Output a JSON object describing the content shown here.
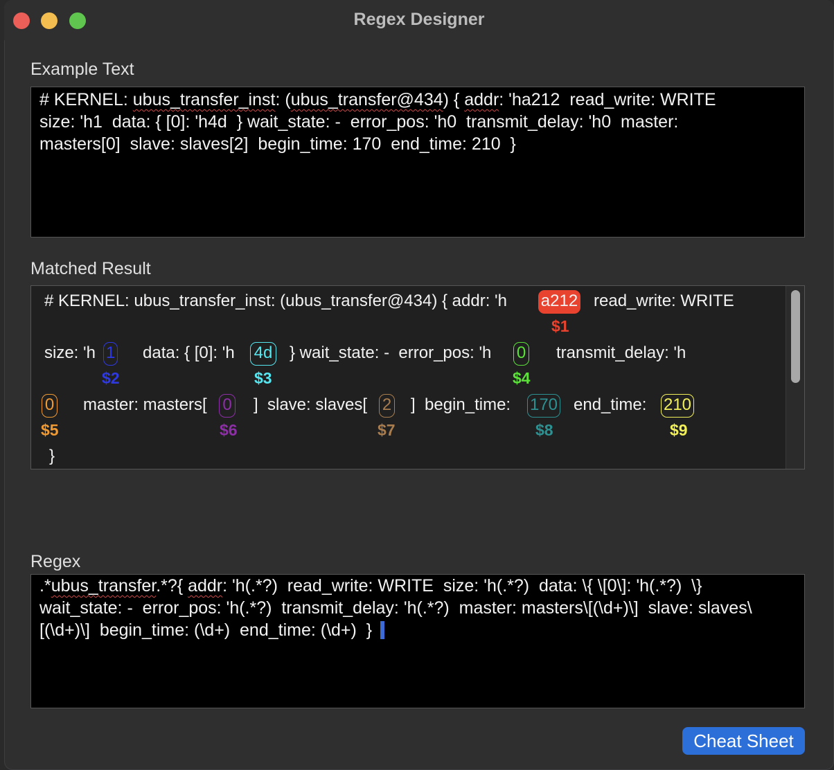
{
  "window": {
    "title": "Regex Designer"
  },
  "example": {
    "label": "Example Text",
    "line1_a": "# KERNEL: ",
    "line1_b": "ubus_transfer_inst",
    "line1_c": ": (",
    "line1_d": "ubus_transfer@434",
    "line1_e": ") { ",
    "line1_f": "addr",
    "line1_g": ": 'ha212  read_write: WRITE",
    "line2": "size: 'h1  data: { [0]: 'h4d  } wait_state: -  error_pos: 'h0  transmit_delay: 'h0  master:",
    "line3": "masters[0]  slave: slaves[2]  begin_time: 170  end_time: 210  }"
  },
  "result": {
    "label": "Matched Result",
    "row1_text": "# KERNEL: ubus_transfer_inst: (ubus_transfer@434) { addr: 'h",
    "row1_tail": "read_write: WRITE",
    "row2_a": "size: 'h",
    "row2_b": "data: { [0]: 'h",
    "row2_c": "} wait_state: -  error_pos: 'h",
    "row2_d": "transmit_delay: 'h",
    "row3_a": "master: masters[",
    "row3_b": "]  slave: slaves[",
    "row3_c": "]  begin_time:",
    "row3_d": "end_time:",
    "row4": "}",
    "captures": [
      {
        "value": "a212",
        "group": "$1",
        "color": "#e8432f"
      },
      {
        "value": "1",
        "group": "$2",
        "color": "#2f39e0"
      },
      {
        "value": "4d",
        "group": "$3",
        "color": "#56e6ef"
      },
      {
        "value": "0",
        "group": "$4",
        "color": "#5ce03a"
      },
      {
        "value": "0",
        "group": "$5",
        "color": "#f09a33"
      },
      {
        "value": "0",
        "group": "$6",
        "color": "#8d2fa6"
      },
      {
        "value": "2",
        "group": "$7",
        "color": "#a97d4e"
      },
      {
        "value": "170",
        "group": "$8",
        "color": "#2d9191"
      },
      {
        "value": "210",
        "group": "$9",
        "color": "#f2f05a"
      }
    ]
  },
  "regex": {
    "label": "Regex",
    "line1_a": ".*",
    "line1_b": "ubus_transfer",
    "line1_c": ".*?{ ",
    "line1_d": "addr",
    "line1_e": ": 'h(.*?)  read_write: WRITE  size: 'h(.*?)  data: \\{ \\[0\\]: 'h(.*?)  \\}",
    "line2": "wait_state: -  error_pos: 'h(.*?)  transmit_delay: 'h(.*?)  master: masters\\[(\\d+)\\]  slave: slaves\\",
    "line3": "[(\\d+)\\]  begin_time: (\\d+)  end_time: (\\d+)  }"
  },
  "buttons": {
    "cheat_sheet": "Cheat Sheet"
  }
}
